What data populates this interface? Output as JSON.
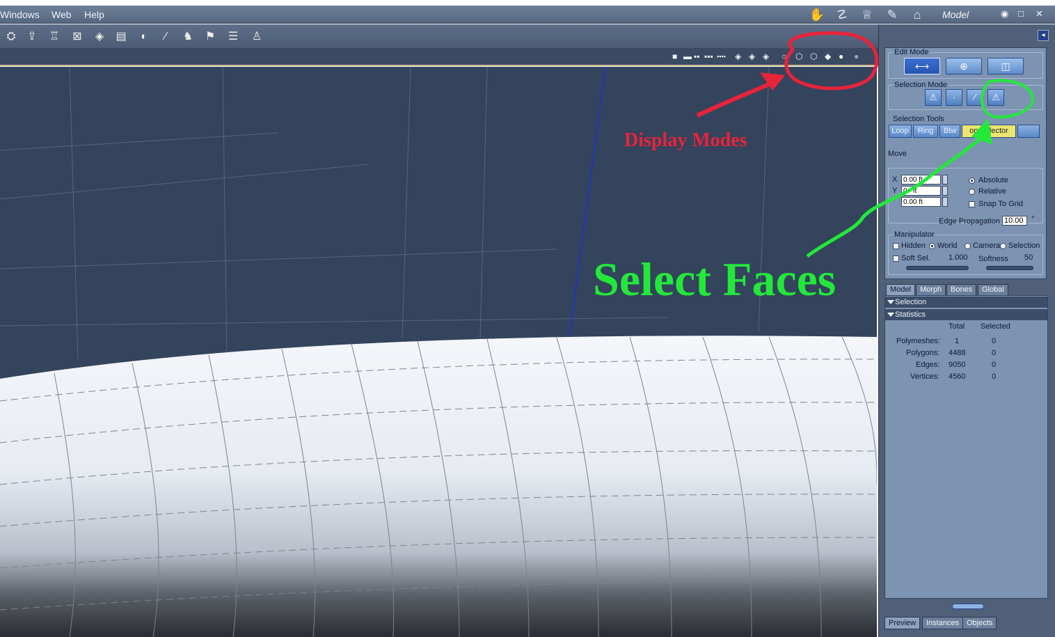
{
  "menu": [
    "Windows",
    "Web",
    "Help"
  ],
  "room": {
    "label": "Model",
    "icons": [
      "hand-icon",
      "lasso-icon",
      "crown-icon",
      "pen-icon",
      "hanger-icon"
    ]
  },
  "window_controls": [
    "◉",
    "□",
    "✕"
  ],
  "toolbar_icons": [
    "lamp-icon",
    "arrow-icon",
    "goblet-icon",
    "box-icon",
    "cube-icon",
    "bag-icon",
    "sphere-icon",
    "brush-icon",
    "figure-icon",
    "pose-icon",
    "camera-icon",
    "prop-icon"
  ],
  "viewport": {
    "layout_buttons": [
      "■",
      "▬",
      "▪▪",
      "▪▪▪",
      "▪▪▪▪"
    ],
    "shade_buttons": [
      "◈",
      "◈",
      "◈"
    ],
    "display_mode_buttons": [
      "○",
      "⬡",
      "⬡",
      "◆",
      "●",
      "●"
    ]
  },
  "panel": {
    "edit_mode": {
      "title": "Edit Mode",
      "buttons": [
        "⟷",
        "⊕",
        "◫"
      ]
    },
    "selection_mode": {
      "title": "Selection Mode",
      "buttons": [
        "⚠",
        "·",
        "∕",
        "⚠"
      ]
    },
    "selection_tools": {
      "title": "Selection Tools",
      "tools": [
        "Loop",
        "Ring",
        "Btw",
        "on Selector"
      ]
    },
    "move": {
      "title": "Move",
      "x_label": "X",
      "x_value": "0.00 ft",
      "y_label": "Y",
      "y_value": "0.  ft",
      "z_value": "0.00 ft",
      "absolute": "Absolute",
      "relative": "Relative",
      "snap": "Snap To Grid",
      "edge_prop_label": "Edge Propagation",
      "edge_prop_value": "10.00",
      "degree": "°"
    },
    "manipulator": {
      "title": "Manipulator",
      "hidden": "Hidden",
      "world": "World",
      "camera": "Camera",
      "selection": "Selection",
      "soft_sel": "Soft Sel.",
      "soft_sel_value": "1.000",
      "softness": "Softness",
      "softness_value": "50"
    },
    "tabs": [
      "Model",
      "Morph",
      "Bones",
      "Global"
    ],
    "tree": {
      "selection": "Selection",
      "statistics": "Statistics",
      "col_total": "Total",
      "col_selected": "Selected",
      "rows": [
        {
          "label": "Polymeshes:",
          "total": "1",
          "selected": "0"
        },
        {
          "label": "Polygons:",
          "total": "4488",
          "selected": "0"
        },
        {
          "label": "Edges:",
          "total": "9050",
          "selected": "0"
        },
        {
          "label": "Vertices:",
          "total": "4560",
          "selected": "0"
        }
      ]
    },
    "bottom_tabs": [
      "Preview",
      "Instances",
      "Objects"
    ]
  },
  "annotations": {
    "display_modes": "Display Modes",
    "select_faces": "Select Faces"
  },
  "colors": {
    "annotation_red": "#e8233a",
    "annotation_green": "#23e83a",
    "viewport_bg": "#33445c",
    "panel_bg": "#7d93b2"
  }
}
